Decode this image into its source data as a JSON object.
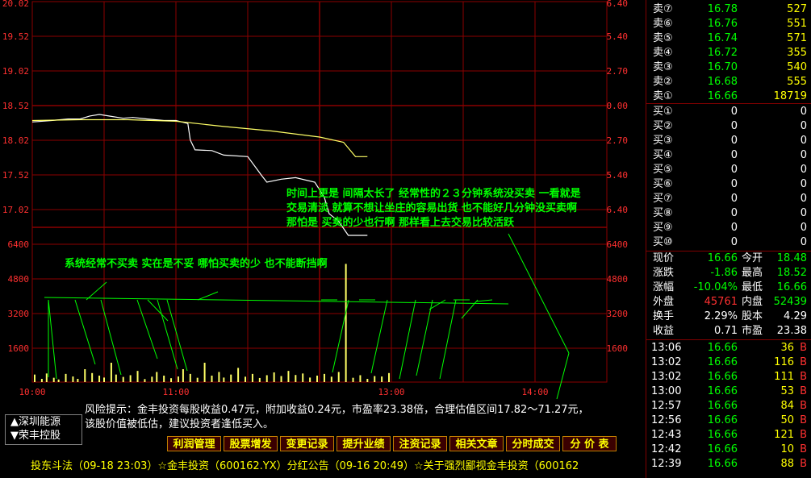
{
  "chart_data": {
    "type": "line",
    "price_axis_left": [
      "20.02",
      "19.52",
      "19.02",
      "18.52",
      "18.02",
      "17.52",
      "17.02"
    ],
    "price_axis_right": [
      "6.40",
      "5.40",
      "2.70",
      "0.00",
      "2.70",
      "5.40",
      "6.40"
    ],
    "volume_axis_left": [
      "6400",
      "4800",
      "3200",
      "1600"
    ],
    "volume_axis_right": [
      "6400",
      "4800",
      "3200",
      "1600"
    ],
    "x_labels": [
      "10:00",
      "11:00",
      "13:00",
      "14:00"
    ],
    "x_label_minutes": [
      0,
      60,
      150,
      210
    ],
    "total_minutes": 240,
    "price_range": [
      17.02,
      20.02
    ],
    "volume_range": [
      0,
      7200
    ],
    "series": [
      {
        "values_minutes": [
          0,
          8,
          15,
          20,
          24,
          28,
          32,
          38,
          42,
          48,
          55,
          60,
          65,
          66,
          68,
          75,
          80,
          90,
          96,
          98,
          104,
          110,
          118,
          122,
          124,
          128,
          132,
          136,
          140
        ],
        "values": [
          18.42,
          18.44,
          18.46,
          18.46,
          18.5,
          18.52,
          18.5,
          18.47,
          18.48,
          18.46,
          18.44,
          18.44,
          18.4,
          18.18,
          18.05,
          18.04,
          17.98,
          17.96,
          17.7,
          17.62,
          17.66,
          17.68,
          17.62,
          17.42,
          17.2,
          17.1,
          16.7,
          16.66,
          16.66
        ],
        "color": "#ffffff"
      },
      {
        "values_minutes": [
          0,
          20,
          40,
          60,
          80,
          100,
          120,
          130,
          135,
          140
        ],
        "values": [
          18.44,
          18.45,
          18.45,
          18.43,
          18.36,
          18.3,
          18.22,
          18.15,
          17.96,
          17.96
        ],
        "color": "#ffff66"
      }
    ],
    "volume_minutes": [
      1,
      4,
      6,
      9,
      11,
      14,
      17,
      19,
      22,
      25,
      28,
      30,
      33,
      35,
      38,
      41,
      44,
      47,
      50,
      52,
      55,
      58,
      61,
      63,
      66,
      69,
      72,
      75,
      78,
      80,
      83,
      86,
      89,
      92,
      95,
      98,
      101,
      104,
      107,
      110,
      113,
      116,
      119,
      122,
      125,
      128,
      131,
      134,
      137,
      140,
      143,
      146,
      149
    ],
    "volume_values": [
      350,
      150,
      400,
      200,
      120,
      380,
      260,
      150,
      600,
      420,
      300,
      210,
      900,
      350,
      240,
      320,
      520,
      140,
      250,
      470,
      300,
      180,
      260,
      600,
      380,
      200,
      900,
      300,
      470,
      210,
      350,
      660,
      250,
      380,
      190,
      320,
      450,
      280,
      520,
      330,
      400,
      210,
      300,
      380,
      250,
      470,
      5500,
      200,
      320,
      150,
      280,
      260,
      420
    ]
  },
  "annotations": {
    "top_note": [
      "时间上更是 间隔太长了 经常性的２３分钟系统没买卖 一看就是",
      "交易清淡 就算不想让坐庄的容易出货 也不能好几分钟没买卖啊",
      "那怕是 买卖的少也行啊 那样看上去交易比较活跃"
    ],
    "bottom_note": "系统经常不买卖 实在是不妥 哪怕买卖的少 也不能断挡啊"
  },
  "order_book": {
    "asks": [
      {
        "label": "卖⑦",
        "price": "16.78",
        "vol": "527"
      },
      {
        "label": "卖⑥",
        "price": "16.76",
        "vol": "551"
      },
      {
        "label": "卖⑤",
        "price": "16.74",
        "vol": "571"
      },
      {
        "label": "卖④",
        "price": "16.72",
        "vol": "355"
      },
      {
        "label": "卖③",
        "price": "16.70",
        "vol": "540"
      },
      {
        "label": "卖②",
        "price": "16.68",
        "vol": "555"
      },
      {
        "label": "卖①",
        "price": "16.66",
        "vol": "18719"
      }
    ],
    "bids": [
      {
        "label": "买①",
        "price": "0",
        "vol": "0"
      },
      {
        "label": "买②",
        "price": "0",
        "vol": "0"
      },
      {
        "label": "买③",
        "price": "0",
        "vol": "0"
      },
      {
        "label": "买④",
        "price": "0",
        "vol": "0"
      },
      {
        "label": "买⑤",
        "price": "0",
        "vol": "0"
      },
      {
        "label": "买⑥",
        "price": "0",
        "vol": "0"
      },
      {
        "label": "买⑦",
        "price": "0",
        "vol": "0"
      },
      {
        "label": "买⑧",
        "price": "0",
        "vol": "0"
      },
      {
        "label": "买⑨",
        "price": "0",
        "vol": "0"
      },
      {
        "label": "买⑩",
        "price": "0",
        "vol": "0"
      }
    ]
  },
  "quote": {
    "rows": [
      {
        "l1": "现价",
        "v1": "16.66",
        "c1": "#00ff00",
        "l2": "今开",
        "v2": "18.48",
        "c2": "#00ff00"
      },
      {
        "l1": "涨跌",
        "v1": "-1.86",
        "c1": "#00ff00",
        "l2": "最高",
        "v2": "18.52",
        "c2": "#00ff00"
      },
      {
        "l1": "涨幅",
        "v1": "-10.04%",
        "c1": "#00ff00",
        "l2": "最低",
        "v2": "16.66",
        "c2": "#00ff00"
      },
      {
        "l1": "外盘",
        "v1": "45761",
        "c1": "#ff3030",
        "l2": "内盘",
        "v2": "52439",
        "c2": "#00ff00"
      },
      {
        "l1": "换手",
        "v1": "2.29%",
        "c1": "#ffffff",
        "l2": "股本",
        "v2": "4.29",
        "c2": "#ffffff"
      },
      {
        "l1": "收益",
        "v1": "0.71",
        "c1": "#ffffff",
        "l2": "市盈",
        "v2": "23.38",
        "c2": "#ffffff"
      }
    ]
  },
  "trades": [
    {
      "time": "13:06",
      "price": "16.66",
      "vol": "36",
      "side": "B"
    },
    {
      "time": "13:02",
      "price": "16.66",
      "vol": "116",
      "side": "B"
    },
    {
      "time": "13:02",
      "price": "16.66",
      "vol": "111",
      "side": "B"
    },
    {
      "time": "13:00",
      "price": "16.66",
      "vol": "53",
      "side": "B"
    },
    {
      "time": "12:57",
      "price": "16.66",
      "vol": "84",
      "side": "B"
    },
    {
      "time": "12:56",
      "price": "16.66",
      "vol": "50",
      "side": "B"
    },
    {
      "time": "12:43",
      "price": "16.66",
      "vol": "121",
      "side": "B"
    },
    {
      "time": "12:42",
      "price": "16.66",
      "vol": "10",
      "side": "B"
    },
    {
      "time": "12:39",
      "price": "16.66",
      "vol": "88",
      "side": "B"
    }
  ],
  "risk": {
    "line1": "风险提示：金丰投资每股收益0.47元，附加收益0.24元，市盈率23.38倍，合理估值区间17.82～71.27元，",
    "line2": "该股价值被低估，建议投资者逢低买入。"
  },
  "buttons": [
    "利润管理",
    "股票增发",
    "变更记录",
    "提升业绩",
    "注资记录",
    "相关文章",
    "分时成交",
    "分 价 表"
  ],
  "stocks": {
    "up": "▲深圳能源",
    "down": "▼荣丰控股"
  },
  "ticker": "投东斗法（09-18 23:03）☆金丰投资（600162.YX）分红公告（09-16 20:49）☆关于强烈鄙视金丰投资（600162",
  "colors": {
    "grid": "#8b0000",
    "price": "#ffffff",
    "avg": "#ffff66",
    "volume": "#ffff66",
    "note": "#00ff00",
    "axis": "#ff3030"
  }
}
